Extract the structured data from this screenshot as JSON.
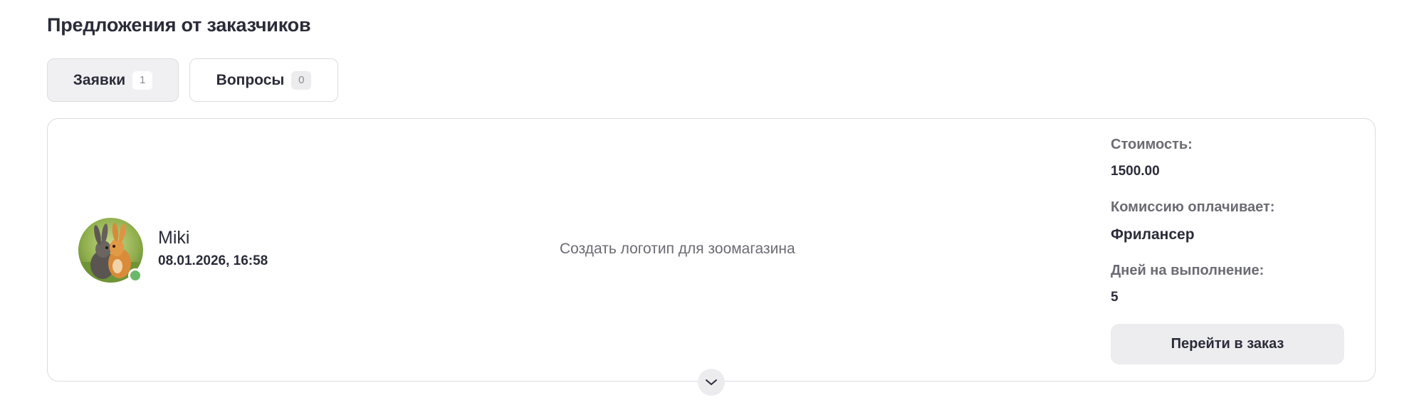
{
  "section": {
    "title": "Предложения от заказчиков"
  },
  "tabs": [
    {
      "label": "Заявки",
      "count": "1",
      "active": true
    },
    {
      "label": "Вопросы",
      "count": "0",
      "active": false
    }
  ],
  "offer": {
    "user": {
      "name": "Miki",
      "datetime": "08.01.2026, 16:58",
      "online": true
    },
    "task_title": "Создать логотип для зоомагазина",
    "cost_label": "Стоимость:",
    "cost_value": "1500.00",
    "commission_label": "Комиссию оплачивает:",
    "commission_value": "Фрилансер",
    "days_label": "Дней на выполнение:",
    "days_value": "5",
    "go_button_label": "Перейти в заказ"
  },
  "icons": {
    "expand": "chevron-down-icon"
  },
  "colors": {
    "online": "#6cb86a",
    "active_tab_bg": "#f0f0f2",
    "button_bg": "#ededef"
  }
}
